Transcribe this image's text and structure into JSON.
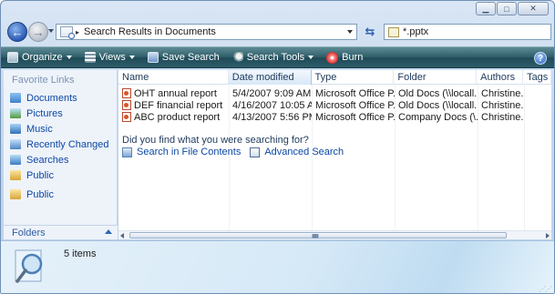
{
  "window": {
    "caption_buttons": {
      "minimize_icon": "minimize-icon",
      "maximize_icon": "maximize-icon",
      "close_icon": "close-icon"
    }
  },
  "navbar": {
    "back_icon": "back-arrow-icon",
    "forward_icon": "forward-arrow-icon",
    "address_path": "Search Results in Documents",
    "address_separator": "▸",
    "refresh_icon": "refresh-icon",
    "search_value": "*.pptx"
  },
  "toolbar": {
    "organize": "Organize",
    "views": "Views",
    "save_search": "Save Search",
    "search_tools": "Search Tools",
    "burn": "Burn",
    "help": "?"
  },
  "navpane": {
    "title": "Favorite Links",
    "items": [
      {
        "label": "Documents",
        "icon": "documents-icon"
      },
      {
        "label": "Pictures",
        "icon": "pictures-icon"
      },
      {
        "label": "Music",
        "icon": "music-icon"
      },
      {
        "label": "Recently Changed",
        "icon": "recently-changed-icon"
      },
      {
        "label": "Searches",
        "icon": "searches-icon"
      },
      {
        "label": "Public",
        "icon": "public-folder-icon"
      },
      {
        "label": "Public",
        "icon": "public-folder-icon"
      }
    ],
    "folders_label": "Folders"
  },
  "columns": [
    "Name",
    "Date modified",
    "Type",
    "Folder",
    "Authors",
    "Tags"
  ],
  "files": [
    {
      "name": "OHT annual report",
      "date": "5/4/2007 9:09 AM",
      "type": "Microsoft Office P...",
      "folder": "Old Docs (\\\\locall...",
      "authors": "Christine..."
    },
    {
      "name": "DEF financial report",
      "date": "4/16/2007 10:05 AM",
      "type": "Microsoft Office P...",
      "folder": "Old Docs (\\\\locall...",
      "authors": "Christine..."
    },
    {
      "name": "ABC product report",
      "date": "4/13/2007 5:56 PM",
      "type": "Microsoft Office P...",
      "folder": "Company Docs (\\...",
      "authors": "Christine..."
    }
  ],
  "search_prompt": {
    "question": "Did you find what you were searching for?",
    "search_in_contents": "Search in File Contents",
    "advanced_search": "Advanced Search"
  },
  "details": {
    "item_count": "5 items"
  },
  "colors": {
    "toolbar_top": "#5e8a94",
    "toolbar_bottom": "#1f4b57",
    "link_blue": "#0c47a4"
  }
}
